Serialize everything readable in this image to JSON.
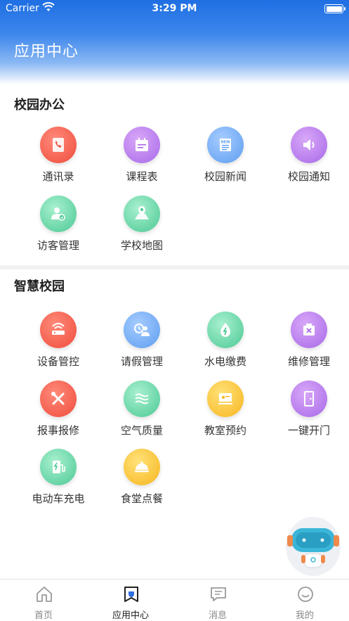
{
  "status_bar": {
    "carrier": "Carrier",
    "time": "3:29 PM"
  },
  "header": {
    "title": "应用中心"
  },
  "sections": [
    {
      "title": "校园办公",
      "items": [
        {
          "label": "通讯录",
          "icon": "contacts-icon",
          "color": "#ef4c3c"
        },
        {
          "label": "课程表",
          "icon": "schedule-icon",
          "color": "#a868e8"
        },
        {
          "label": "校园新闻",
          "icon": "news-icon",
          "color": "#5d9df0"
        },
        {
          "label": "校园通知",
          "icon": "speaker-icon",
          "color": "#a868e8"
        },
        {
          "label": "访客管理",
          "icon": "visitor-icon",
          "color": "#4cc995"
        },
        {
          "label": "学校地图",
          "icon": "map-icon",
          "color": "#4cc995"
        }
      ]
    },
    {
      "title": "智慧校园",
      "items": [
        {
          "label": "设备管控",
          "icon": "router-icon",
          "color": "#ef4c3c"
        },
        {
          "label": "请假管理",
          "icon": "leave-icon",
          "color": "#5d9df0"
        },
        {
          "label": "水电缴费",
          "icon": "utility-icon",
          "color": "#4cc995"
        },
        {
          "label": "维修管理",
          "icon": "repair-box-icon",
          "color": "#a868e8"
        },
        {
          "label": "报事报修",
          "icon": "tools-icon",
          "color": "#ef4c3c"
        },
        {
          "label": "空气质量",
          "icon": "air-icon",
          "color": "#4cc995"
        },
        {
          "label": "教室预约",
          "icon": "classroom-icon",
          "color": "#f7b51d"
        },
        {
          "label": "一键开门",
          "icon": "door-icon",
          "color": "#a868e8"
        },
        {
          "label": "电动车充电",
          "icon": "charger-icon",
          "color": "#4cc995"
        },
        {
          "label": "食堂点餐",
          "icon": "dining-icon",
          "color": "#f7b51d"
        }
      ]
    }
  ],
  "tabbar": [
    {
      "label": "首页",
      "icon": "home-icon",
      "active": false
    },
    {
      "label": "应用中心",
      "icon": "app-center-icon",
      "active": true
    },
    {
      "label": "消息",
      "icon": "message-icon",
      "active": false
    },
    {
      "label": "我的",
      "icon": "profile-icon",
      "active": false
    }
  ],
  "assistant": {
    "icon": "robot-assistant-icon"
  }
}
